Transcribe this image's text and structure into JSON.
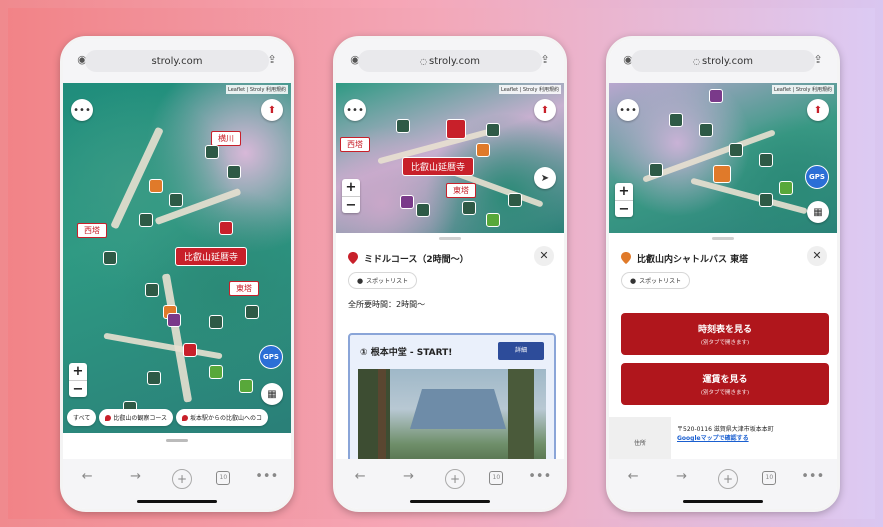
{
  "colors": {
    "accent_red": "#b0161c",
    "map_teal": "#2a8f7e",
    "detail_blue": "#2d4c9a",
    "gps_blue": "#2b6fd6"
  },
  "phones": [
    {
      "url": "stroly.com",
      "attribution": "Leaflet | Stroly 利用規約",
      "map_signs": [
        "横川",
        "西塔",
        "東塔"
      ],
      "temple_banner": "比叡山延暦寺",
      "gps_label": "GPS",
      "zoom_in": "+",
      "zoom_out": "−",
      "filters": [
        "すべて",
        "比叡山の観察コース",
        "坂本駅からの比叡山へのコ"
      ]
    },
    {
      "url": "stroly.com",
      "attribution": "Leaflet | Stroly 利用規約",
      "map_signs": [
        "西塔",
        "東塔"
      ],
      "temple_banner": "比叡山延暦寺",
      "zoom_in": "+",
      "zoom_out": "−",
      "sheet_title": "ミドルコース（2時間〜）",
      "spot_chip": "スポットリスト",
      "total_time": "全所要時間：2時間〜",
      "card_title": "① 根本中堂 - START!",
      "detail_label": "詳細"
    },
    {
      "url": "stroly.com",
      "attribution": "Leaflet | Stroly 利用規約",
      "gps_label": "GPS",
      "zoom_in": "+",
      "zoom_out": "−",
      "sheet_title": "比叡山内シャトルバス 東塔",
      "spot_chip": "スポットリスト",
      "button1_main": "時刻表を見る",
      "button1_sub": "(別タブで開きます)",
      "button2_main": "運賃を見る",
      "button2_sub": "(別タブで開きます)",
      "address_key": "住所",
      "address_value": "〒520-0116 滋賀県大津市坂本本町",
      "address_link": "Googleマップで確認する"
    }
  ],
  "browser": {
    "back": "←",
    "forward": "→",
    "new_tab": "+",
    "tab_count": "10",
    "more": "•••"
  },
  "icons": {
    "menu": "ellipsis-icon",
    "compass": "compass-icon",
    "locate": "navigation-arrow-icon",
    "close": "close-icon",
    "pin": "map-pin-icon"
  }
}
